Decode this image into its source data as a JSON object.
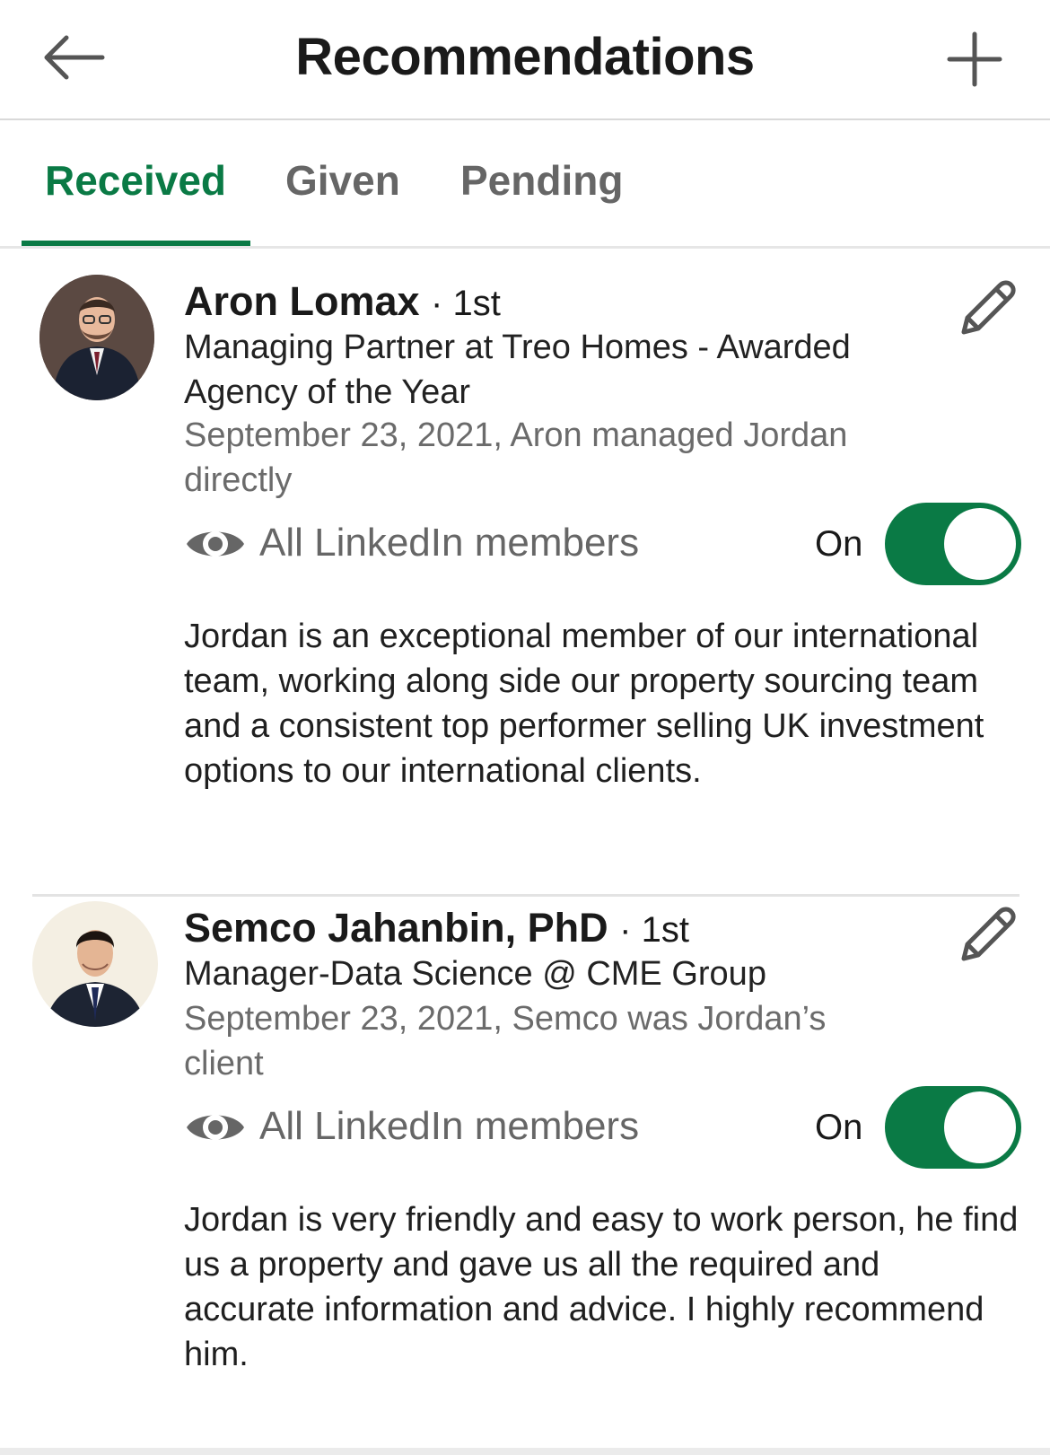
{
  "header": {
    "title": "Recommendations",
    "back_icon": "arrow-left-icon",
    "add_icon": "plus-icon"
  },
  "tabs": [
    {
      "label": "Received",
      "active": true
    },
    {
      "label": "Given",
      "active": false
    },
    {
      "label": "Pending",
      "active": false
    }
  ],
  "theme": {
    "accent": "#0a7a45",
    "muted_text": "#666666",
    "divider": "#e3e3e3"
  },
  "recommendations": [
    {
      "name": "Aron Lomax",
      "degree": "· 1st",
      "headline": "Managing Partner at Treo Homes - Awarded Agency of the Year",
      "meta": "September 23, 2021, Aron managed Jordan directly",
      "visibility": "All LinkedIn members",
      "toggle_label": "On",
      "toggle_on": true,
      "text": "Jordan is an exceptional member of our international team, working along side our property sourcing team and a consistent top performer selling UK investment options to our international clients."
    },
    {
      "name": "Semco Jahanbin, PhD",
      "degree": "· 1st",
      "headline": "Manager-Data Science @ CME Group",
      "meta": "September 23, 2021, Semco was Jordan’s client",
      "visibility": "All LinkedIn members",
      "toggle_label": "On",
      "toggle_on": true,
      "text": "Jordan is very friendly and easy to work person, he find us a property and gave us all the required and accurate information and advice. I highly recommend him."
    }
  ]
}
